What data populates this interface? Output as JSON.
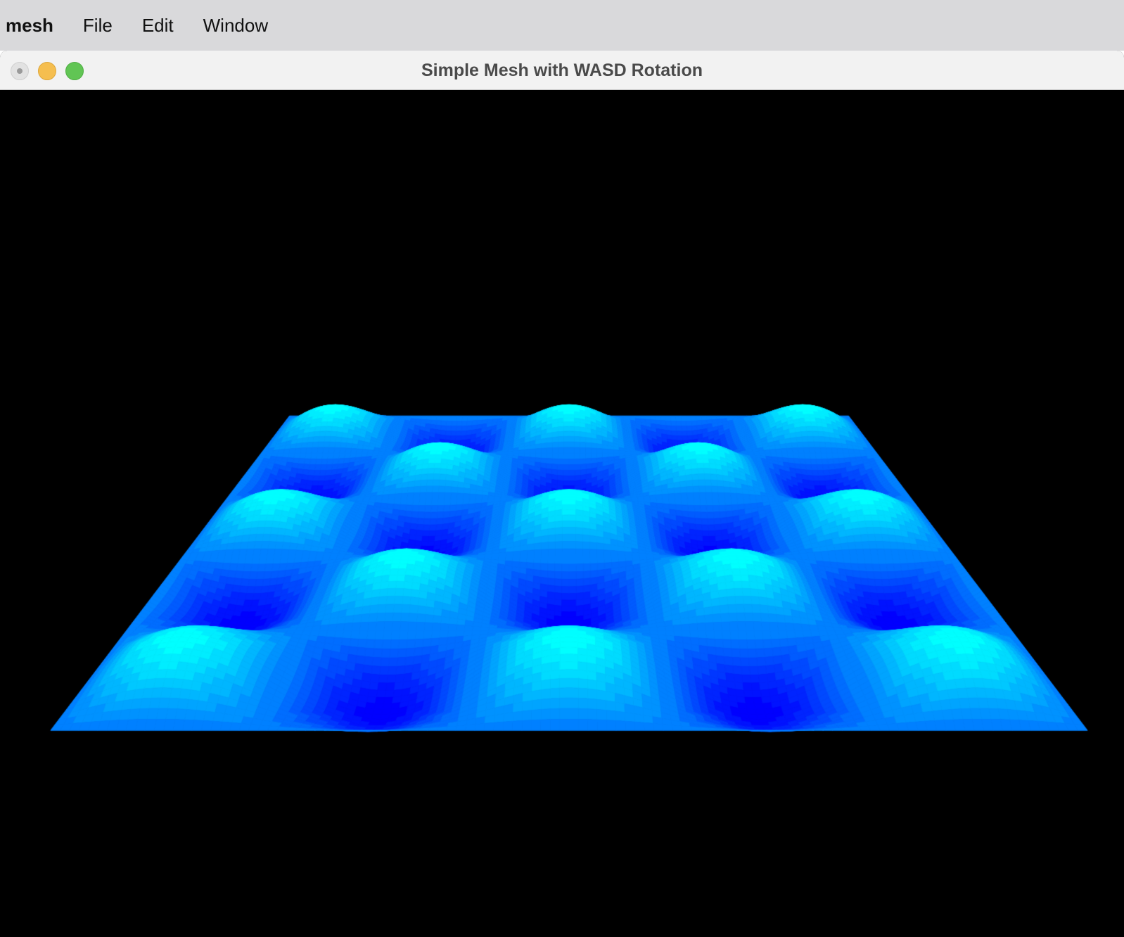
{
  "menubar": {
    "app_name": "mesh",
    "items": [
      "File",
      "Edit",
      "Window"
    ]
  },
  "window": {
    "title": "Simple Mesh with WASD Rotation"
  },
  "scene": {
    "background_color": "#000000",
    "mesh_color_low": "#0000ff",
    "mesh_color_high": "#00ffff",
    "surface": "sine-wave grid",
    "bumps_per_side": 5
  }
}
